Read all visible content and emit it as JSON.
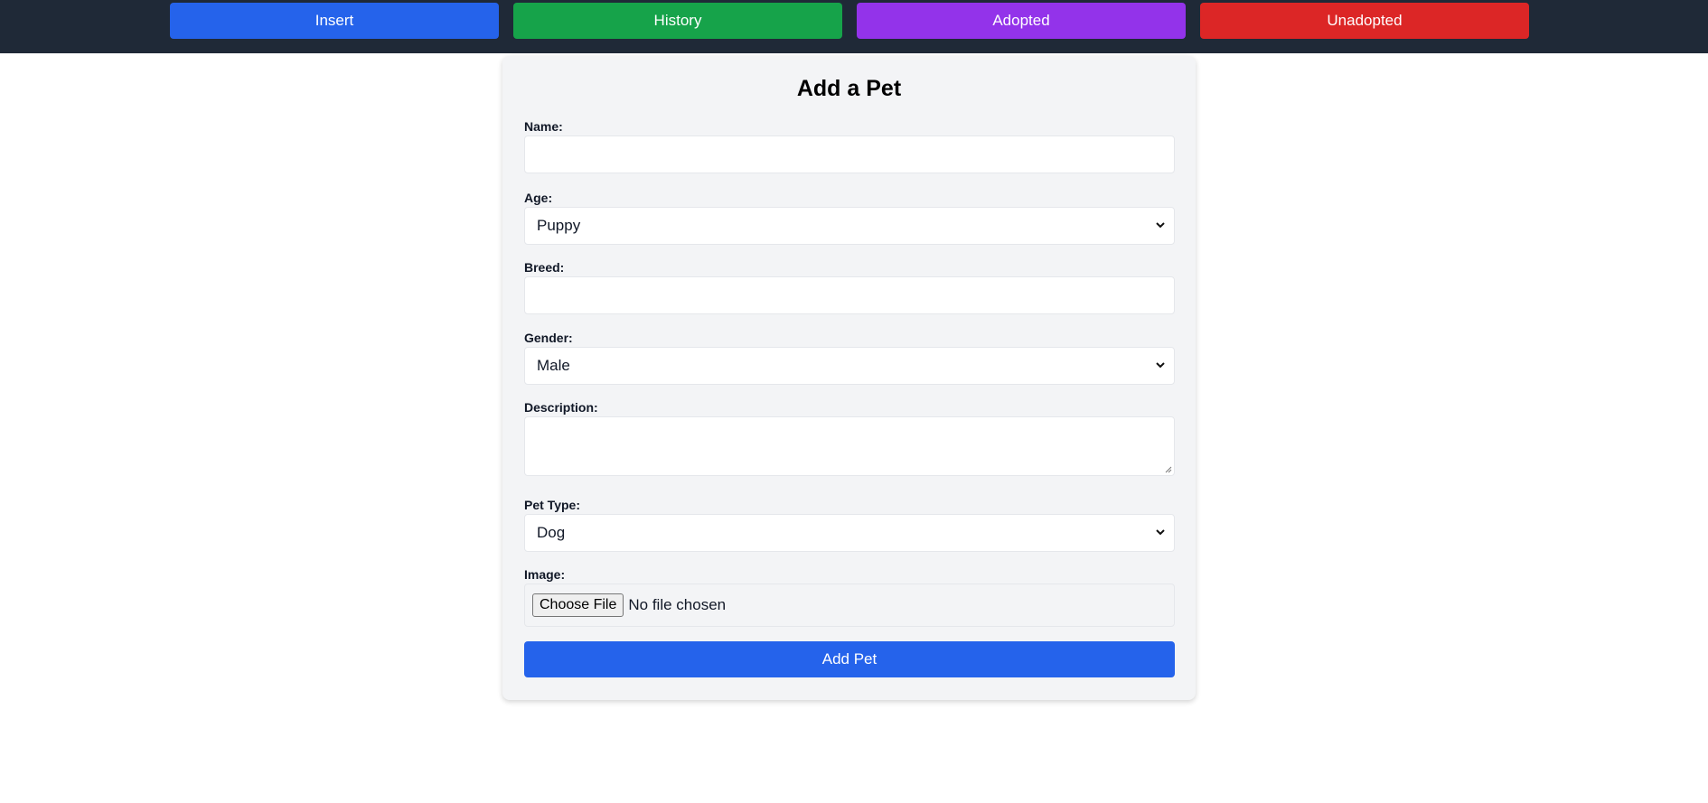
{
  "nav": {
    "insert": {
      "label": "Insert",
      "color": "#2563eb"
    },
    "history": {
      "label": "History",
      "color": "#16a34a"
    },
    "adopted": {
      "label": "Adopted",
      "color": "#9333ea"
    },
    "unadopted": {
      "label": "Unadopted",
      "color": "#dc2626"
    }
  },
  "form": {
    "title": "Add a Pet",
    "name": {
      "label": "Name:",
      "value": ""
    },
    "age": {
      "label": "Age:",
      "selected": "Puppy"
    },
    "breed": {
      "label": "Breed:",
      "value": ""
    },
    "gender": {
      "label": "Gender:",
      "selected": "Male"
    },
    "description": {
      "label": "Description:",
      "value": ""
    },
    "pet_type": {
      "label": "Pet Type:",
      "selected": "Dog"
    },
    "image": {
      "label": "Image:",
      "button": "Choose File",
      "status": "No file chosen"
    },
    "submit_label": "Add Pet"
  },
  "colors": {
    "topbar": "#1f2937",
    "card": "#f3f4f6",
    "submit": "#2563eb"
  }
}
